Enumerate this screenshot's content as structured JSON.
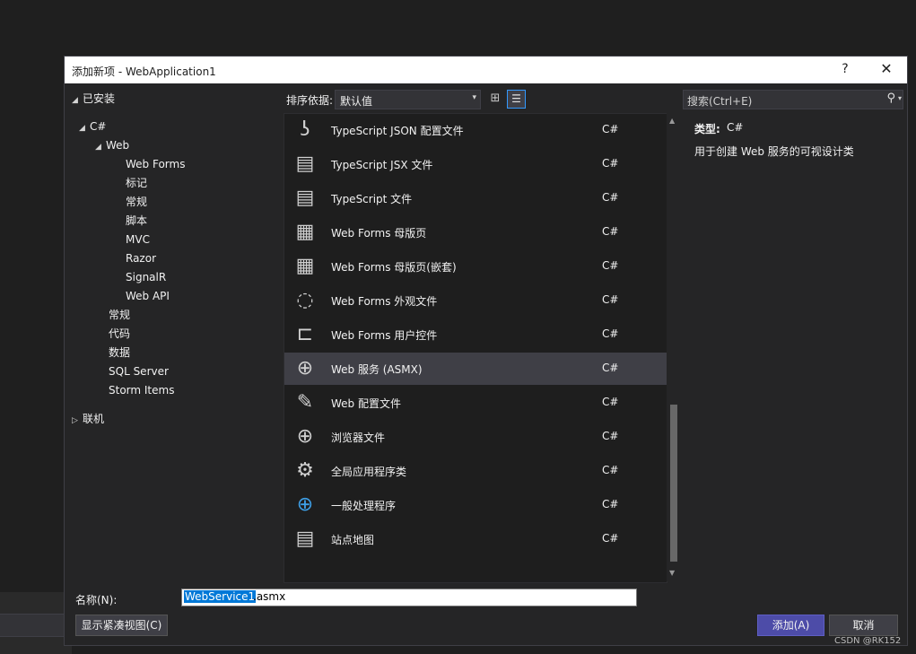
{
  "dialog": {
    "title": "添加新项 - WebApplication1",
    "help": "?",
    "close": "✕"
  },
  "tree": {
    "installed": "已安装",
    "csharp": "C#",
    "web": "Web",
    "web_children": [
      "Web Forms",
      "标记",
      "常规",
      "脚本",
      "MVC",
      "Razor",
      "SignalR",
      "Web API"
    ],
    "csharp_children": [
      "常规",
      "代码",
      "数据",
      "SQL Server",
      "Storm Items"
    ],
    "online": "联机"
  },
  "sortbar": {
    "label": "排序依据:",
    "value": "默认值"
  },
  "search": {
    "placeholder": "搜索(Ctrl+E)"
  },
  "items": [
    {
      "name": "TypeScript JSON 配置文件",
      "lang": "C#",
      "icon": "ts-json-config-icon"
    },
    {
      "name": "TypeScript JSX 文件",
      "lang": "C#",
      "icon": "ts-jsx-file-icon"
    },
    {
      "name": "TypeScript 文件",
      "lang": "C#",
      "icon": "ts-file-icon"
    },
    {
      "name": "Web Forms 母版页",
      "lang": "C#",
      "icon": "master-page-icon"
    },
    {
      "name": "Web Forms 母版页(嵌套)",
      "lang": "C#",
      "icon": "nested-master-page-icon"
    },
    {
      "name": "Web Forms 外观文件",
      "lang": "C#",
      "icon": "skin-file-icon"
    },
    {
      "name": "Web Forms 用户控件",
      "lang": "C#",
      "icon": "user-control-icon"
    },
    {
      "name": "Web 服务 (ASMX)",
      "lang": "C#",
      "icon": "web-service-icon",
      "selected": true
    },
    {
      "name": "Web 配置文件",
      "lang": "C#",
      "icon": "web-config-icon"
    },
    {
      "name": "浏览器文件",
      "lang": "C#",
      "icon": "browser-file-icon"
    },
    {
      "name": "全局应用程序类",
      "lang": "C#",
      "icon": "global-app-class-icon"
    },
    {
      "name": "一般处理程序",
      "lang": "C#",
      "icon": "generic-handler-icon"
    },
    {
      "name": "站点地图",
      "lang": "C#",
      "icon": "site-map-icon"
    }
  ],
  "details": {
    "type_label": "类型:",
    "type_value": "C#",
    "description": "用于创建 Web 服务的可视设计类"
  },
  "name_field": {
    "label": "名称(N):",
    "selected": "WebService1",
    "rest": ".asmx"
  },
  "buttons": {
    "compact": "显示紧凑视图(C)",
    "add": "添加(A)",
    "cancel": "取消"
  },
  "watermark": "CSDN @RK152",
  "colors": {
    "accent": "#4d4ca8",
    "selection": "#3f3f46",
    "input_highlight": "#0078d7"
  }
}
